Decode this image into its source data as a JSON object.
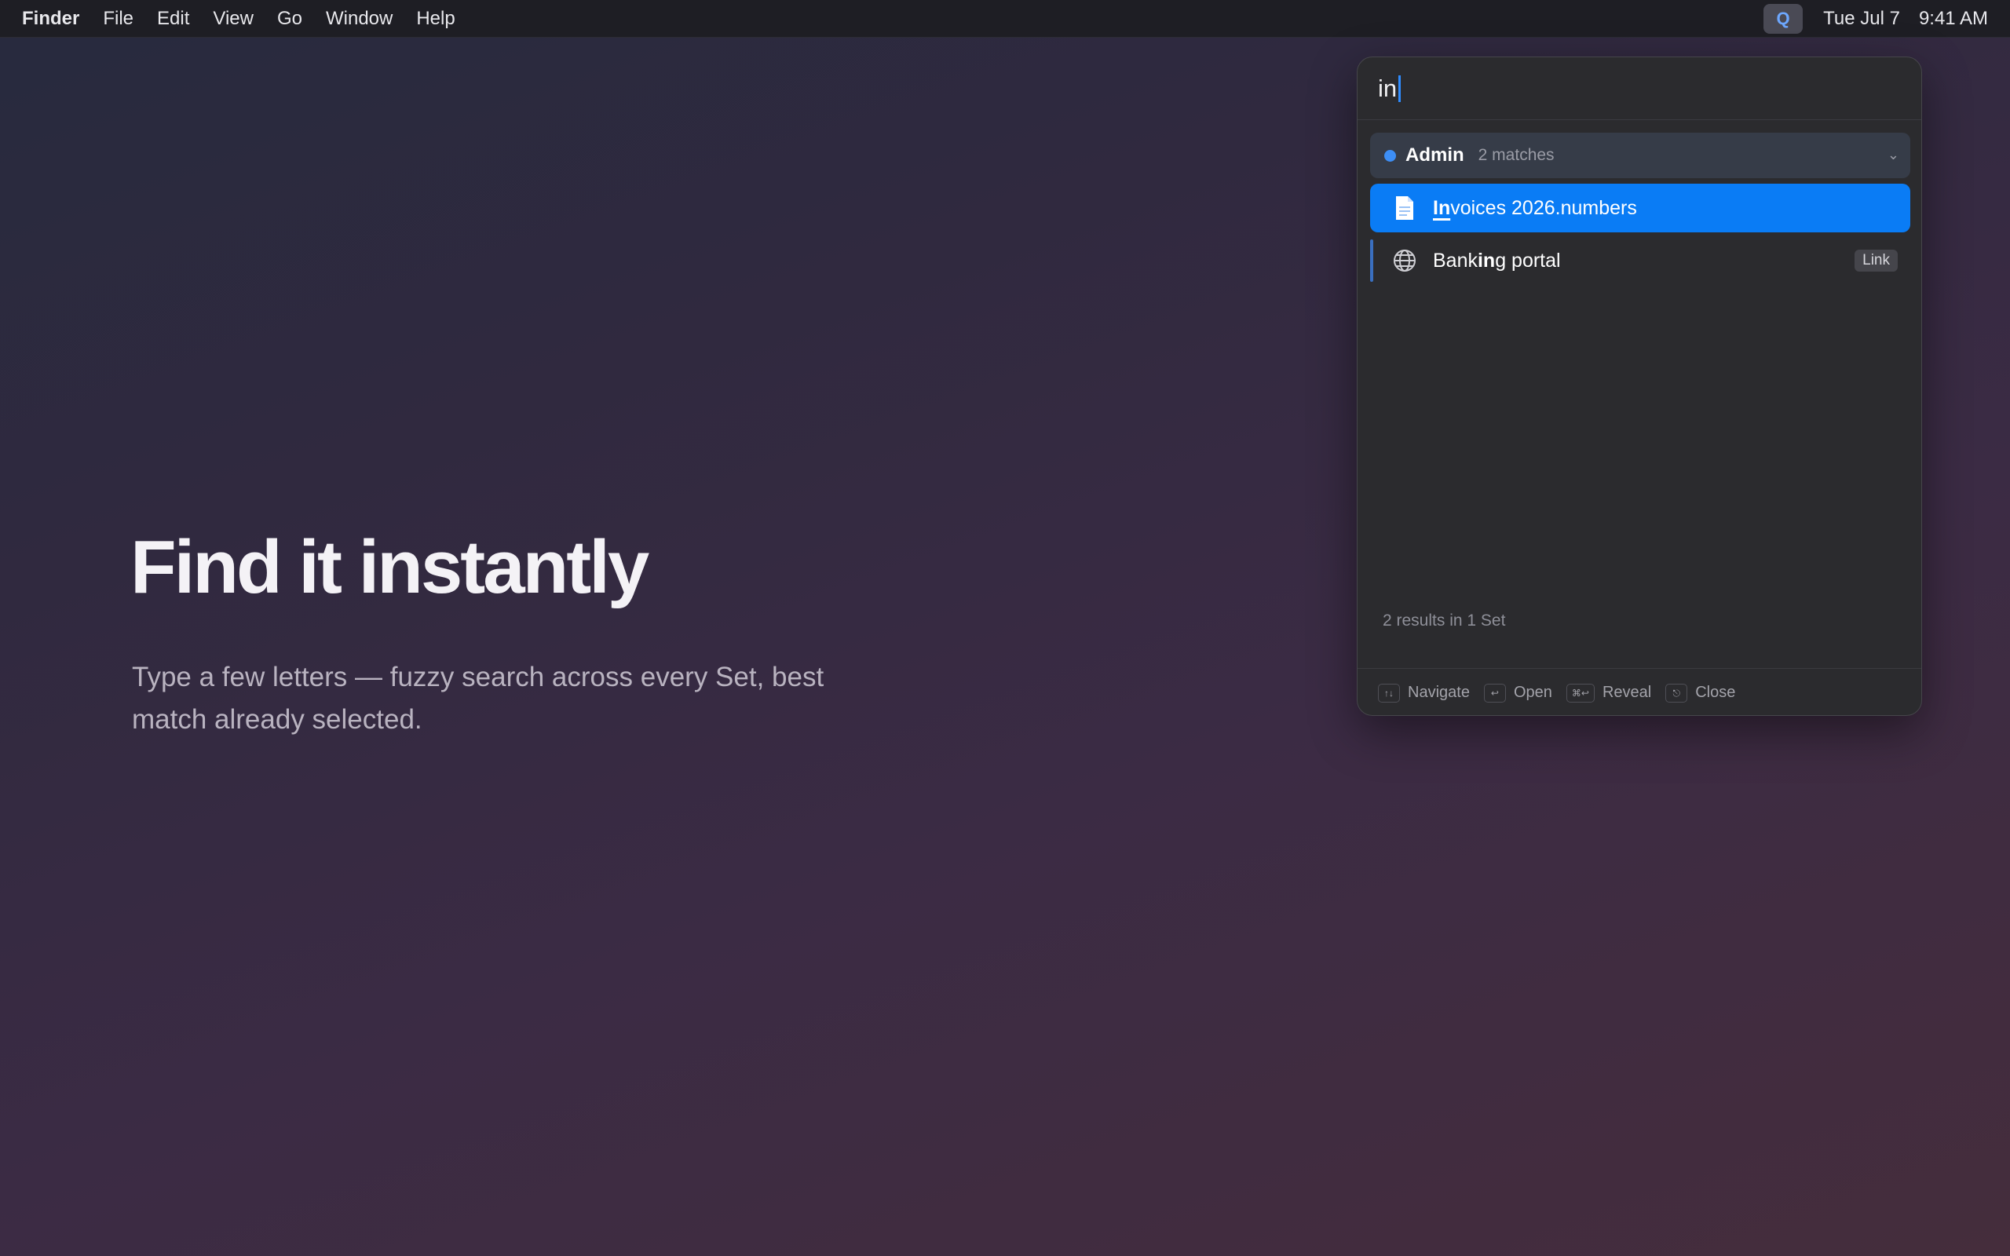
{
  "menubar": {
    "app_name": "Finder",
    "menus": [
      "File",
      "Edit",
      "View",
      "Go",
      "Window",
      "Help"
    ],
    "status_icon_letter": "Q",
    "date": "Tue Jul 7",
    "time": "9:41 AM"
  },
  "hero": {
    "title": "Find it instantly",
    "subtitle": "Type a few letters — fuzzy search across every Set, best match already selected."
  },
  "panel": {
    "query": "in",
    "group": {
      "name": "Admin",
      "count_label": "2 matches",
      "dot_color": "#3d8ef5",
      "chevron_icon": "chevron-down-icon"
    },
    "results": [
      {
        "title": "Invoices 2026.numbers",
        "match_prefix": "In",
        "rest": "voices 2026.numbers",
        "icon": "document-icon",
        "selected": true
      },
      {
        "title": "Banking portal",
        "pre": "Bank",
        "match": "in",
        "post": "g portal",
        "icon": "globe-icon",
        "badge": "Link",
        "selected": false
      }
    ],
    "summary": "2 results in 1 Set",
    "footer_hints": [
      {
        "key": "↑↓",
        "label": "Navigate"
      },
      {
        "key": "↩",
        "label": "Open"
      },
      {
        "key": "⌘↩",
        "label": "Reveal"
      },
      {
        "key": "⎋",
        "label": "Close"
      }
    ]
  },
  "colors": {
    "selection": "#0a7cf5",
    "caret": "#2f8cff",
    "accent_dot": "#3d8ef5"
  }
}
